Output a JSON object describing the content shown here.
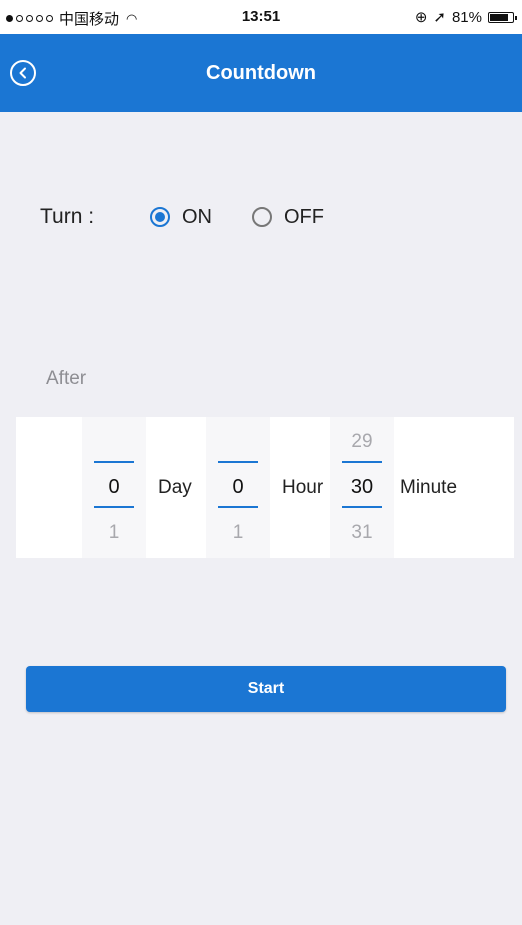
{
  "status_bar": {
    "carrier": "中国移动",
    "time": "13:51",
    "battery": "81%",
    "battery_level": 0.81
  },
  "nav": {
    "title": "Countdown",
    "back_icon": "back-circle-icon"
  },
  "turn": {
    "label": "Turn :",
    "options": [
      {
        "label": "ON",
        "selected": true
      },
      {
        "label": "OFF",
        "selected": false
      }
    ]
  },
  "after_label": "After",
  "picker": {
    "day": {
      "prev": "",
      "current": "0",
      "next": "1",
      "unit": "Day"
    },
    "hour": {
      "prev": "",
      "current": "0",
      "next": "1",
      "unit": "Hour"
    },
    "minute": {
      "prev": "29",
      "current": "30",
      "next": "31",
      "unit": "Minute"
    }
  },
  "start_button": "Start",
  "colors": {
    "accent": "#1b76d3",
    "background": "#efeff4"
  }
}
